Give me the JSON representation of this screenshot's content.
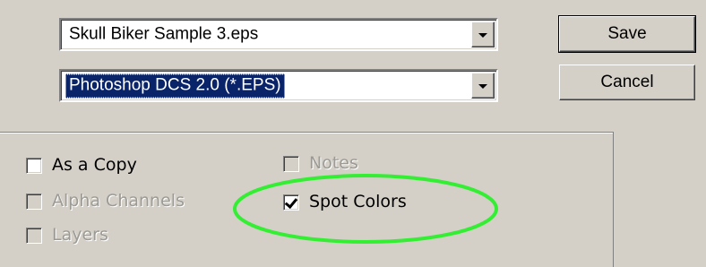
{
  "dialog": {
    "file_name": {
      "value": "Skull Biker Sample 3.eps"
    },
    "format": {
      "value": "Photoshop DCS 2.0 (*.EPS)"
    },
    "buttons": {
      "save": "Save",
      "cancel": "Cancel"
    }
  },
  "options": {
    "as_a_copy": {
      "label": "As a Copy",
      "checked": false,
      "enabled": true
    },
    "notes": {
      "label": "Notes",
      "checked": false,
      "enabled": false
    },
    "alpha_channels": {
      "label": "Alpha Channels",
      "checked": false,
      "enabled": false
    },
    "spot_colors": {
      "label": "Spot Colors",
      "checked": true,
      "enabled": true
    },
    "layers": {
      "label": "Layers",
      "checked": false,
      "enabled": false
    }
  },
  "annotation": {
    "highlight_color": "#33ee33",
    "target": "Spot Colors"
  },
  "colors": {
    "dialog_bg": "#d4d0c8",
    "selection_bg": "#0a246a",
    "disabled_text": "#9c9a94"
  }
}
